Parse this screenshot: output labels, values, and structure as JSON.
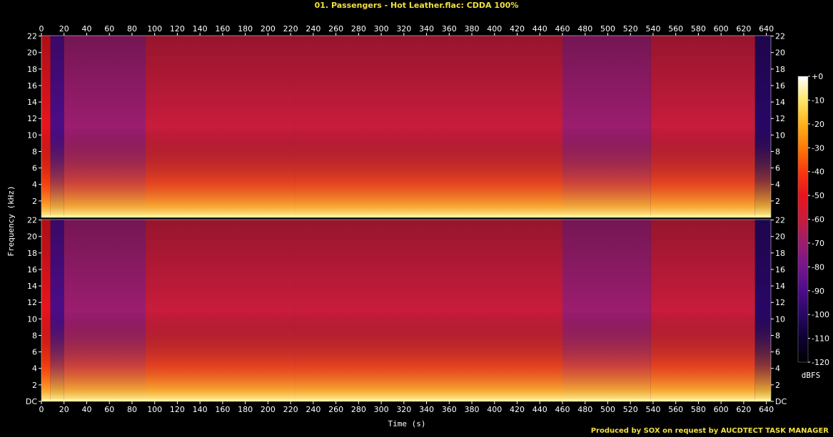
{
  "chart_data": {
    "type": "heatmap",
    "title": "01. Passengers - Hot Leather.flac: CDDA 100%",
    "xlabel": "Time (s)",
    "ylabel": "Frequency (kHz)",
    "xlim": [
      0,
      644
    ],
    "x_ticks": [
      "0",
      "20",
      "40",
      "60",
      "80",
      "100",
      "120",
      "140",
      "160",
      "180",
      "200",
      "220",
      "240",
      "260",
      "280",
      "300",
      "320",
      "340",
      "360",
      "380",
      "400",
      "420",
      "440",
      "460",
      "480",
      "500",
      "520",
      "540",
      "560",
      "580",
      "600",
      "620",
      "640"
    ],
    "y_ticks": [
      "DC",
      "2",
      "4",
      "6",
      "8",
      "10",
      "12",
      "14",
      "16",
      "18",
      "20",
      "22"
    ],
    "y_ticks_top": [
      "2",
      "4",
      "6",
      "8",
      "10",
      "12",
      "14",
      "16",
      "18",
      "20",
      "22"
    ],
    "ylim_khz": [
      0,
      22.05
    ],
    "channels": 2,
    "colorbar": {
      "label": "dBFS",
      "ticks": [
        "+0",
        "-10",
        "-20",
        "-30",
        "-40",
        "-50",
        "-60",
        "-70",
        "-80",
        "-90",
        "-100",
        "-110",
        "-120"
      ],
      "range_db": [
        -120,
        0
      ],
      "colors": [
        "#000000",
        "#0d0130",
        "#280765",
        "#4d0c88",
        "#75168d",
        "#9b1d6f",
        "#c81c3c",
        "#e8141d",
        "#f9380e",
        "#fd7a07",
        "#ffb21c",
        "#ffe66a",
        "#ffffff"
      ]
    },
    "segments": [
      {
        "start": 0,
        "end": 8,
        "level_db": -55
      },
      {
        "start": 8,
        "end": 20,
        "level_db": -95
      },
      {
        "start": 20,
        "end": 92,
        "level_db": -75
      },
      {
        "start": 92,
        "end": 224,
        "level_db": -60
      },
      {
        "start": 224,
        "end": 460,
        "level_db": -58
      },
      {
        "start": 460,
        "end": 538,
        "level_db": -75
      },
      {
        "start": 538,
        "end": 630,
        "level_db": -60
      },
      {
        "start": 630,
        "end": 644,
        "level_db": -100
      }
    ]
  },
  "credit": "Produced by SOX on request by AUCDTECT TASK MANAGER"
}
